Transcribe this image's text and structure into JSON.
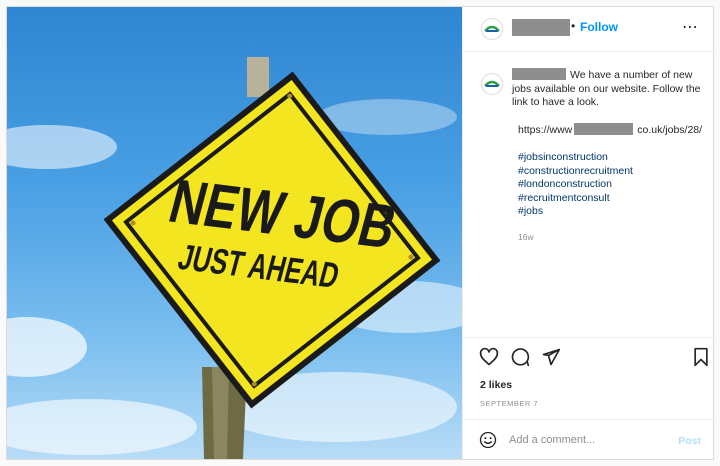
{
  "media": {
    "sign_line1": "NEW JOB",
    "sign_line2": "JUST AHEAD"
  },
  "header": {
    "follow_label": "Follow",
    "separator": "•",
    "more_icon": "⋯"
  },
  "caption": {
    "text": "We have a number of new jobs available on our website. Follow the link to have a look.",
    "link_prefix": "https://www",
    "link_suffix": "co.uk/jobs/28/",
    "hashtags": [
      "#jobsinconstruction",
      "#constructionrecruitment",
      "#londonconstruction",
      "#recruitmentconsult",
      "#jobs"
    ],
    "age": "16w"
  },
  "actions": {
    "likes": "2 likes",
    "date": "SEPTEMBER 7"
  },
  "comment": {
    "placeholder": "Add a comment...",
    "post_label": "Post"
  },
  "colors": {
    "accent": "#0095f6",
    "link": "#00376b",
    "sign_yellow": "#f3e51f"
  }
}
